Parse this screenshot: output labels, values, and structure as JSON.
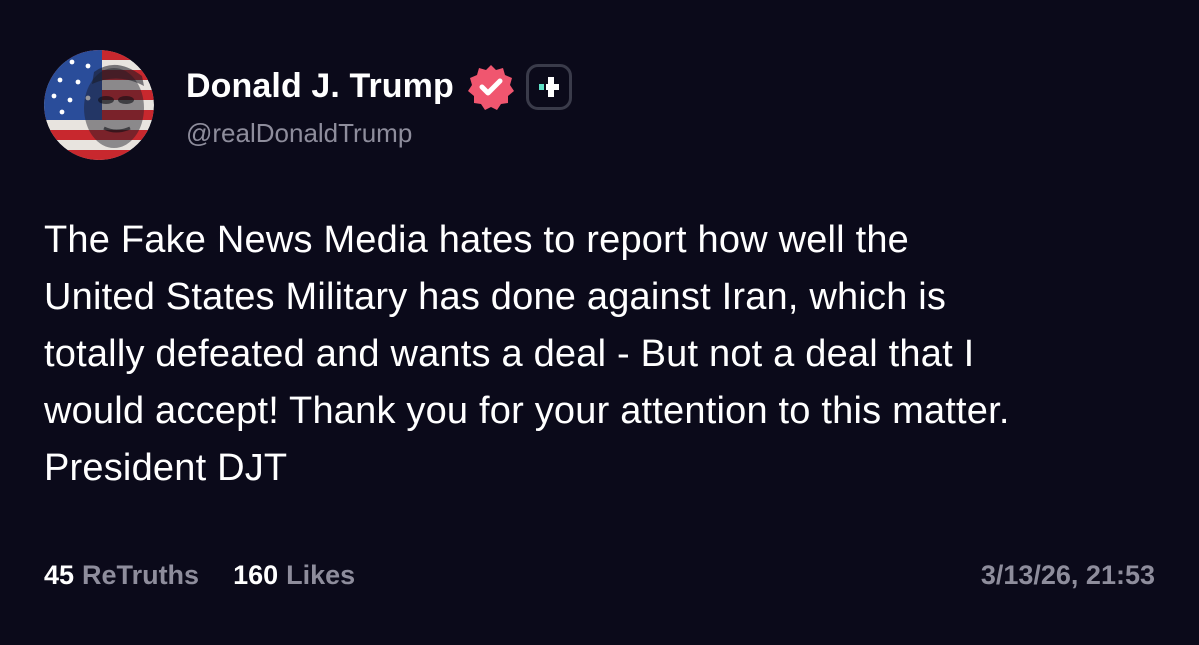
{
  "author": {
    "display_name": "Donald J. Trump",
    "handle": "@realDonaldTrump",
    "verified_icon": "verified-badge-icon",
    "plus_icon": "plus-badge-icon"
  },
  "post": {
    "lines": [
      "The Fake News Media hates to report how well the",
      "United States Military has done against Iran, which is",
      "totally defeated and wants a deal - But not a deal that I",
      "would accept! Thank you for your attention to this matter.",
      "President DJT"
    ]
  },
  "footer": {
    "retruths_count": "45",
    "retruths_label": "ReTruths",
    "likes_count": "160",
    "likes_label": "Likes",
    "timestamp": "3/13/26, 21:53"
  },
  "colors": {
    "background": "#0b0a1a",
    "text_primary": "#ffffff",
    "text_secondary": "#8e8d9c",
    "verified_badge": "#f0566f",
    "plus_badge_accent": "#5fe0c6"
  }
}
